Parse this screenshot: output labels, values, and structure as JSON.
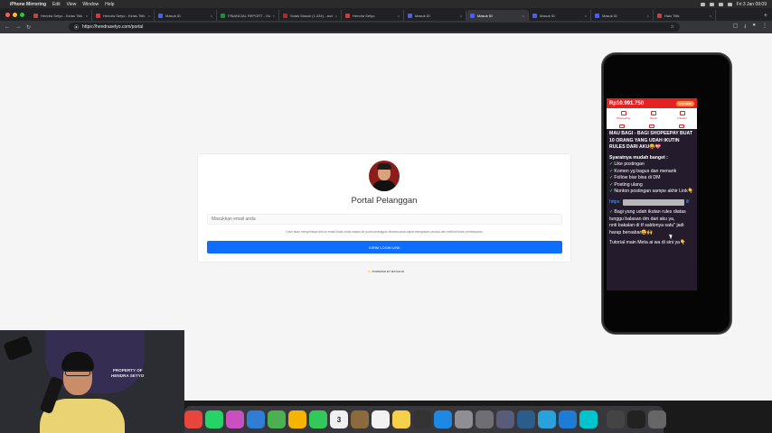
{
  "menubar": {
    "app_name": "iPhone Mirroring",
    "menus": [
      "Edit",
      "View",
      "Window",
      "Help"
    ],
    "datetime": "Fri 3 Jan 09:09"
  },
  "browser": {
    "tabs": [
      {
        "label": "Hendra Setyo - Kelas Titik",
        "favicon_color": "#d33b3b"
      },
      {
        "label": "Hendra Setyo - Kelas Titik",
        "favicon_color": "#d33b3b"
      },
      {
        "label": "Masuk ID",
        "favicon_color": "#4a5cff"
      },
      {
        "label": "FINANCIAL REPORT - Googl",
        "favicon_color": "#1e8e3e"
      },
      {
        "label": "Sotak Masuk (1.034) - arch",
        "favicon_color": "#c5221f"
      },
      {
        "label": "Hendra Setyo",
        "favicon_color": "#d33b3b"
      },
      {
        "label": "Masuk ID",
        "favicon_color": "#4a5cff"
      },
      {
        "label": "Masuk ID",
        "favicon_color": "#4a5cff"
      },
      {
        "label": "Masuk ID",
        "favicon_color": "#4a5cff"
      },
      {
        "label": "Masuk ID",
        "favicon_color": "#4a5cff"
      },
      {
        "label": "Halo Titik",
        "favicon_color": "#d33b3b"
      }
    ],
    "active_tab_index": 7,
    "url": "https://hendrasetyo.com/portal"
  },
  "portal": {
    "title": "Portal Pelanggan",
    "email_placeholder": "Masukkan email anda",
    "note": "Kami akan mengirimkan link ke email Anda untuk masuk ke portal pelanggan dimana anda dapat mengakses produk dan melihat histori pembayaran",
    "button_label": "KIRIM LOGIN LINK",
    "powered_by": "POWERED BY MAYAR.ID",
    "accent": "#0d6efd"
  },
  "phone": {
    "balance": "Rp10.991.750",
    "header_pill": "8 CLAIMS",
    "shortcuts": [
      "ShopeePay",
      "Bayar",
      "Transfer"
    ],
    "message": {
      "title": "MAU BAGI - BAGI SHOPEEPAY BUAT 10 ORANG YANG UDAH IKUTIN RULES DARI AKU😝💝",
      "rules_heading": "Syaratnya mudah banget :",
      "rules": [
        "Like postingan",
        "Komen yg bagus dan menarik",
        "Follow biar bisa di DM",
        "Posting ulang",
        "Nonton postingan sampe akhir Link👇"
      ],
      "link_prefix": "https:",
      "link_suffix": "il/",
      "after_rule": "Bagi yang udah ikutan rules diatas tunggu balasan dm dari aku ya,",
      "followup": "nnti bakalan di tf saldonya satu\" jadi harap bersabar😀🙌",
      "footer": "Tutorial main Meta ai wa di sini ya👇"
    }
  },
  "webcam": {
    "watermark_line1": "PROPERTY OF",
    "watermark_line2": "HENDRA SETYO"
  },
  "dock": {
    "apps": [
      {
        "name": "chrome",
        "color": "#e8453c"
      },
      {
        "name": "whatsapp",
        "color": "#25d366"
      },
      {
        "name": "flower",
        "color": "#c850c0"
      },
      {
        "name": "mail",
        "color": "#2f7dd4"
      },
      {
        "name": "maps",
        "color": "#4caf50"
      },
      {
        "name": "photos",
        "color": "#f4b400"
      },
      {
        "name": "facetime",
        "color": "#34c759"
      },
      {
        "name": "calendar",
        "color": "#f0f0f0"
      },
      {
        "name": "notes-brown",
        "color": "#8b6a3e"
      },
      {
        "name": "reminders",
        "color": "#f2f2f2"
      },
      {
        "name": "notes",
        "color": "#f7d04a"
      },
      {
        "name": "calculator",
        "color": "#333333"
      },
      {
        "name": "app-store",
        "color": "#1e88e5"
      },
      {
        "name": "settings",
        "color": "#8e8e93"
      },
      {
        "name": "xcode",
        "color": "#6e6e73"
      },
      {
        "name": "games",
        "color": "#5a5a7a"
      },
      {
        "name": "quicktime",
        "color": "#2b5d8a"
      },
      {
        "name": "telegram",
        "color": "#2aa1da"
      },
      {
        "name": "shazam",
        "color": "#1c7cd6"
      },
      {
        "name": "canva",
        "color": "#00c4cc"
      },
      {
        "name": "obs",
        "color": "#444444"
      },
      {
        "name": "iphone-mirroring",
        "color": "#222222"
      },
      {
        "name": "trash",
        "color": "#666666"
      }
    ],
    "calendar_day": "3"
  }
}
